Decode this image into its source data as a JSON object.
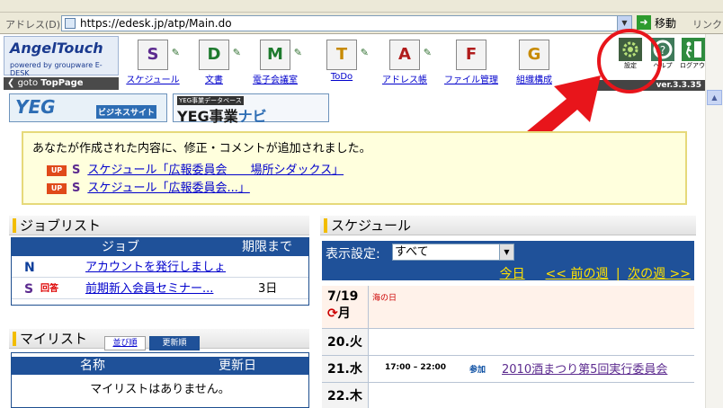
{
  "browser": {
    "address_label": "アドレス(D)",
    "url": "https://edesk.jp/atp/Main.do",
    "go_label": "移動",
    "links_label": "リンク"
  },
  "header": {
    "logo_title": "AngelTouch",
    "logo_sub": "powered by groupware E-DESK",
    "goto_prefix": "goto",
    "goto_target": "TopPage",
    "nav": [
      {
        "glyph": "S",
        "label": "スケジュール",
        "color": "#5c2b8f"
      },
      {
        "glyph": "D",
        "label": "文書",
        "color": "#1e7a2e"
      },
      {
        "glyph": "M",
        "label": "電子会議室",
        "color": "#1e7a2e"
      },
      {
        "glyph": "T",
        "label": "ToDo",
        "color": "#c78a00"
      },
      {
        "glyph": "A",
        "label": "アドレス帳",
        "color": "#b01c1c"
      },
      {
        "glyph": "F",
        "label": "ファイル管理",
        "color": "#b01c1c"
      },
      {
        "glyph": "G",
        "label": "組織構成",
        "color": "#c78a00"
      }
    ],
    "settings_label": "設定",
    "help_label": "ヘルプ",
    "logout_label": "ログアウト",
    "version": "ver.3.3.35"
  },
  "banners": {
    "yeg_title": "YEG",
    "yeg_sub": "ビジネスサイト",
    "navi_sub": "YEG事業データベース",
    "navi_title_a": "YEG事業",
    "navi_title_b": "ナビ"
  },
  "notice": {
    "message": "あなたが作成された内容に、修正・コメントが追加されました。",
    "items": [
      {
        "badge": "UP",
        "glyph": "S",
        "text": "スケジュール「広報委員会　　場所シダックス」"
      },
      {
        "badge": "UP",
        "glyph": "S",
        "text": "スケジュール「広報委員会...」"
      }
    ]
  },
  "joblist": {
    "title": "ジョブリスト",
    "col_job": "ジョブ",
    "col_deadline": "期限まで",
    "rows": [
      {
        "glyph": "N",
        "tag": "",
        "text": "アカウントを発行しましょ",
        "deadline": ""
      },
      {
        "glyph": "S",
        "tag": "回答",
        "text": "前期新入会員セミナー...",
        "deadline": "3日"
      }
    ]
  },
  "mylist": {
    "title": "マイリスト",
    "tab_order": "並び順",
    "tab_updated": "更新順",
    "col_name": "名称",
    "col_updated": "更新日",
    "empty": "マイリストはありません。"
  },
  "schedule": {
    "title": "スケジュール",
    "filter_label": "表示設定:",
    "filter_value": "すべて",
    "today": "今日",
    "prev_week": "<< 前の週",
    "sep": "|",
    "next_week": "次の週 >>",
    "days": [
      {
        "date": "7/19",
        "weekday": "月",
        "holiday": "海の日",
        "time": "",
        "tag": "",
        "event": ""
      },
      {
        "date": "20.",
        "weekday": "火",
        "holiday": "",
        "time": "",
        "tag": "",
        "event": ""
      },
      {
        "date": "21.",
        "weekday": "水",
        "holiday": "",
        "time": "17:00 – 22:00",
        "tag": "参加",
        "event": "2010酒まつり第5回実行委員会"
      },
      {
        "date": "22.",
        "weekday": "木",
        "holiday": "",
        "time": "",
        "tag": "",
        "event": ""
      }
    ]
  },
  "colors": {
    "accent_blue": "#1f5199",
    "annotation_red": "#e8151b",
    "panel_marker": "#f2bd00"
  }
}
